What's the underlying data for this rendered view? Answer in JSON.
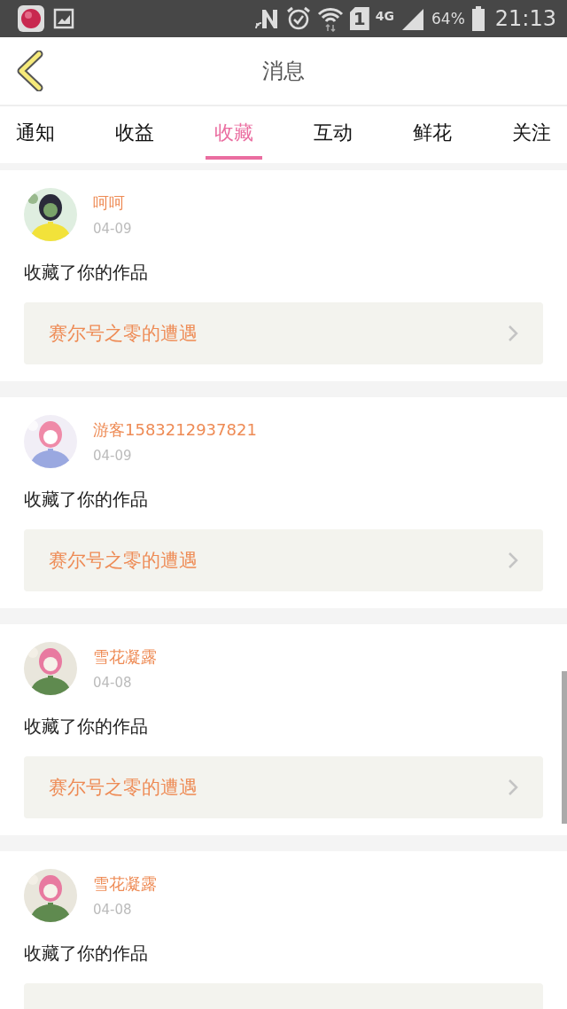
{
  "status_bar": {
    "sim": "1",
    "network": "4G",
    "battery": "64%",
    "time": "21:13"
  },
  "header": {
    "title": "消息"
  },
  "tabs": [
    {
      "label": "通知",
      "selected": false
    },
    {
      "label": "收益",
      "selected": false
    },
    {
      "label": "收藏",
      "selected": true
    },
    {
      "label": "互动",
      "selected": false
    },
    {
      "label": "鲜花",
      "selected": false
    },
    {
      "label": "关注",
      "selected": false
    }
  ],
  "messages": [
    {
      "name": "呵呵",
      "date": "04-09",
      "action": "收藏了你的作品",
      "work": "赛尔号之零的遭遇"
    },
    {
      "name": "游客1583212937821",
      "date": "04-09",
      "action": "收藏了你的作品",
      "work": "赛尔号之零的遭遇"
    },
    {
      "name": "雪花凝露",
      "date": "04-08",
      "action": "收藏了你的作品",
      "work": "赛尔号之零的遭遇"
    },
    {
      "name": "雪花凝露",
      "date": "04-08",
      "action": "收藏了你的作品"
    }
  ]
}
